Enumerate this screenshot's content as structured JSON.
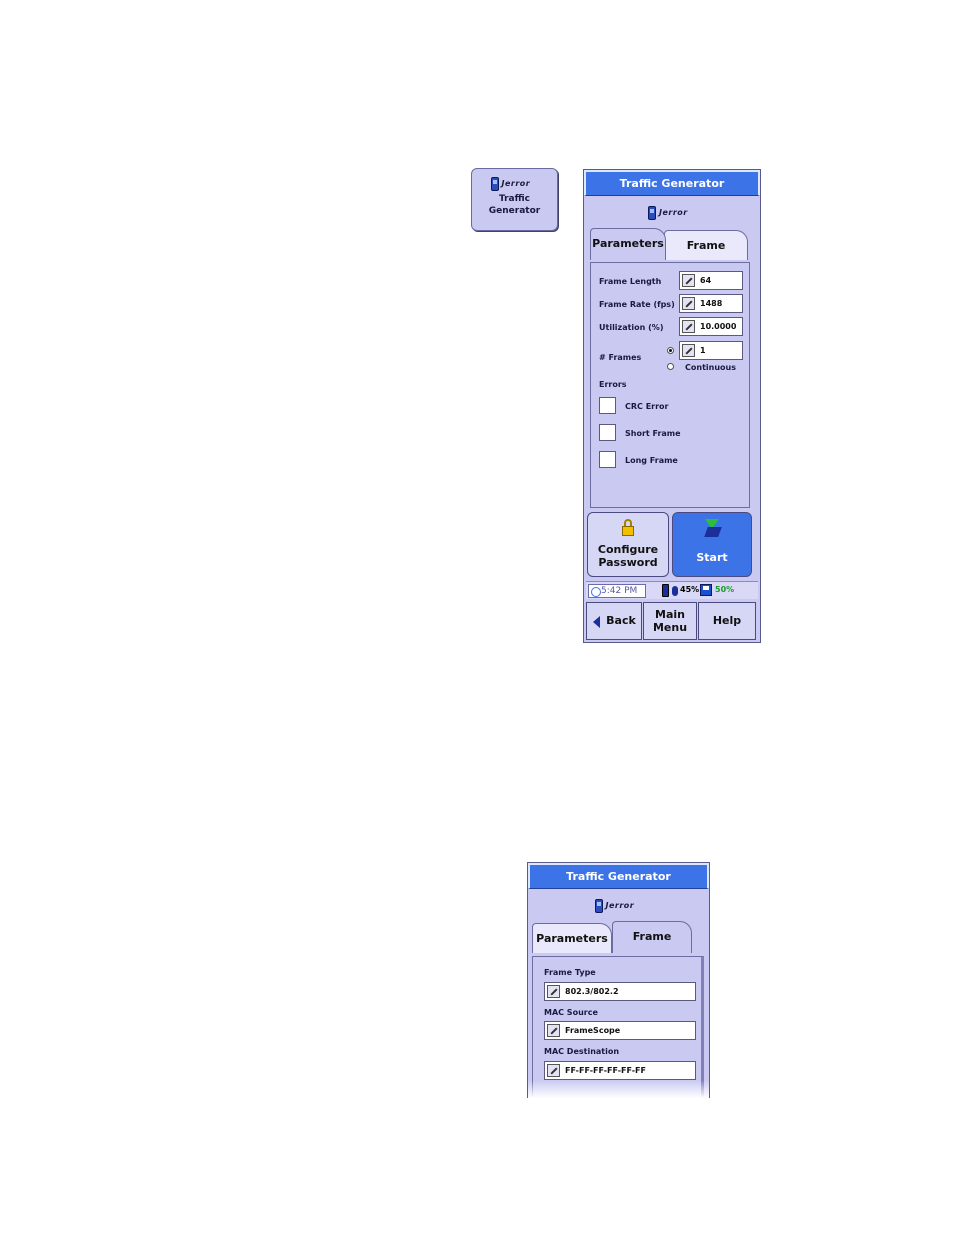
{
  "launcher": {
    "brand": "Jerror",
    "label_line1": "Traffic",
    "label_line2": "Generator"
  },
  "panel1": {
    "title": "Traffic Generator",
    "brand": "Jerror",
    "tabs": [
      "Parameters",
      "Frame"
    ],
    "active_tab": "Parameters",
    "fields": {
      "frame_length": {
        "label": "Frame Length",
        "value": "64"
      },
      "frame_rate": {
        "label": "Frame Rate (fps)",
        "value": "1488"
      },
      "utilization": {
        "label": "Utilization (%)",
        "value": "10.0000"
      },
      "num_frames": {
        "label": "# Frames",
        "value": "1",
        "continuous_label": "Continuous",
        "selected": "count"
      }
    },
    "errors": {
      "heading": "Errors",
      "items": [
        {
          "label": "CRC Error",
          "checked": false
        },
        {
          "label": "Short Frame",
          "checked": false
        },
        {
          "label": "Long Frame",
          "checked": false
        }
      ]
    },
    "buttons": {
      "configure_line1": "Configure",
      "configure_line2": "Password",
      "start": "Start"
    },
    "status": {
      "time": "5:42 PM",
      "memory_pct": "45%",
      "disk_pct": "50%",
      "memory_color": "#1a1a40",
      "disk_color": "#1b9a2a"
    },
    "nav": {
      "back": "Back",
      "main_line1": "Main",
      "main_line2": "Menu",
      "help": "Help"
    }
  },
  "panel2": {
    "title": "Traffic Generator",
    "brand": "Jerror",
    "tabs": [
      "Parameters",
      "Frame"
    ],
    "active_tab": "Frame",
    "fields": [
      {
        "label": "Frame Type",
        "value": "802.3/802.2"
      },
      {
        "label": "MAC Source",
        "value": "FrameScope"
      },
      {
        "label": "MAC Destination",
        "value": "FF-FF-FF-FF-FF-FF"
      }
    ]
  },
  "colors": {
    "accent": "#3c74e8",
    "panel_bg": "#c9c9f2"
  }
}
